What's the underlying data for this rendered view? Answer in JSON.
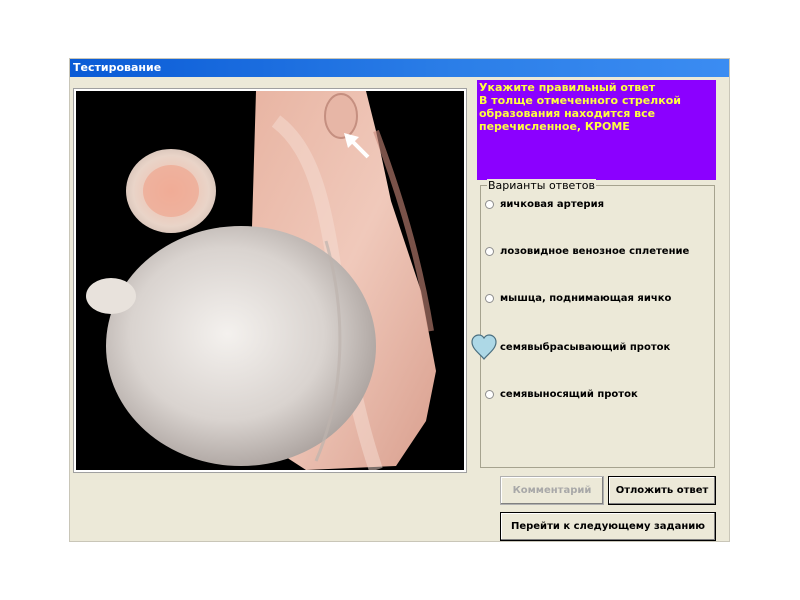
{
  "window": {
    "title": "Тестирование"
  },
  "question": {
    "lines": [
      "Укажите правильный ответ",
      "В толще отмеченного стрелкой",
      "образования находится все",
      "перечисленное, КРОМЕ"
    ]
  },
  "answers": {
    "legend": "Варианты ответов",
    "options": [
      "яичковая артерия",
      "лозовидное венозное сплетение",
      "мышца, поднимающая яичко",
      "семявыбрасывающий проток",
      "семявыносящий проток"
    ],
    "selected_index": 3
  },
  "buttons": {
    "comment": "Комментарий",
    "postpone": "Отложить ответ",
    "next": "Перейти к следующему заданию"
  },
  "colors": {
    "question_bg": "#8b00ff",
    "question_text": "#ffff40",
    "titlebar": "#0a5bd6",
    "selection_marker": "#add8e6"
  },
  "icons": {
    "selection_marker": "heart-icon",
    "pointer": "arrow-icon"
  }
}
